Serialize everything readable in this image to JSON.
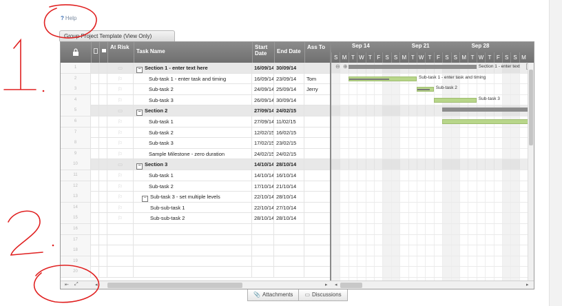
{
  "help": {
    "icon": "?",
    "label": "Help"
  },
  "sheet_tab": {
    "label": "Group Project Template (View Only)"
  },
  "columns": {
    "at_risk": "At Risk",
    "task_name": "Task Name",
    "start_date": "Start Date",
    "end_date": "End Date",
    "assigned_to": "Ass To"
  },
  "rows": [
    {
      "num": "1",
      "name": "Section 1 - enter text here",
      "start": "16/09/14",
      "end": "30/09/14",
      "assigned": "",
      "section": true
    },
    {
      "num": "2",
      "name": "Sub-task 1 - enter task and timing",
      "start": "16/09/14",
      "end": "23/09/14",
      "assigned": "Tom"
    },
    {
      "num": "3",
      "name": "Sub-task 2",
      "start": "24/09/14",
      "end": "25/09/14",
      "assigned": "Jerry"
    },
    {
      "num": "4",
      "name": "Sub-task 3",
      "start": "26/09/14",
      "end": "30/09/14",
      "assigned": ""
    },
    {
      "num": "5",
      "name": "Section 2",
      "start": "27/09/14",
      "end": "24/02/15",
      "assigned": "",
      "section": true
    },
    {
      "num": "6",
      "name": "Sub-task 1",
      "start": "27/09/14",
      "end": "11/02/15",
      "assigned": ""
    },
    {
      "num": "7",
      "name": "Sub-task 2",
      "start": "12/02/15",
      "end": "16/02/15",
      "assigned": ""
    },
    {
      "num": "8",
      "name": "Sub-task 3",
      "start": "17/02/15",
      "end": "23/02/15",
      "assigned": ""
    },
    {
      "num": "9",
      "name": "Sample Milestone - zero duration",
      "start": "24/02/15",
      "end": "24/02/15",
      "assigned": ""
    },
    {
      "num": "10",
      "name": "Section 3",
      "start": "14/10/14",
      "end": "28/10/14",
      "assigned": "",
      "section": true
    },
    {
      "num": "11",
      "name": "Sub-task 1",
      "start": "14/10/14",
      "end": "16/10/14",
      "assigned": ""
    },
    {
      "num": "12",
      "name": "Sub-task 2",
      "start": "17/10/14",
      "end": "21/10/14",
      "assigned": ""
    },
    {
      "num": "13",
      "name": "Sub-task 3 - set multiple levels",
      "start": "22/10/14",
      "end": "28/10/14",
      "assigned": "",
      "parent": true
    },
    {
      "num": "14",
      "name": "Sub-sub-task 1",
      "start": "22/10/14",
      "end": "27/10/14",
      "assigned": ""
    },
    {
      "num": "15",
      "name": "Sub-sub-task 2",
      "start": "28/10/14",
      "end": "28/10/14",
      "assigned": ""
    },
    {
      "num": "16",
      "name": "",
      "start": "",
      "end": "",
      "assigned": ""
    },
    {
      "num": "17",
      "name": "",
      "start": "",
      "end": "",
      "assigned": ""
    },
    {
      "num": "18",
      "name": "",
      "start": "",
      "end": "",
      "assigned": ""
    },
    {
      "num": "19",
      "name": "",
      "start": "",
      "end": "",
      "assigned": ""
    },
    {
      "num": "20",
      "name": "",
      "start": "",
      "end": "",
      "assigned": ""
    }
  ],
  "gantt": {
    "weeks": [
      "Sep 14",
      "Sep 21",
      "Sep 28"
    ],
    "days": [
      "S",
      "M",
      "T",
      "W",
      "T",
      "F",
      "S",
      "S",
      "M",
      "T",
      "W",
      "T",
      "F",
      "S",
      "S",
      "M",
      "T",
      "W",
      "T",
      "F",
      "S",
      "S",
      "M"
    ],
    "bar_labels": {
      "section1": "Section 1 - enter text",
      "subtask1": "Sub-task 1 - enter task and timing",
      "subtask2": "Sub-task 2",
      "subtask3": "Sub-task 3"
    },
    "zoom_in_icon": "zoom-in-icon",
    "zoom_out_icon": "zoom-out-icon"
  },
  "bottom_tabs": {
    "attachments": "Attachments",
    "discussions": "Discussions"
  },
  "annotations": {
    "one": "1.",
    "two": "2."
  },
  "colors": {
    "header": "#7c7c7c",
    "task_bar": "#b8d68a",
    "summary_bar": "#8c8c8c",
    "annotation": "#e02020",
    "help_accent": "#3c6fb4"
  }
}
